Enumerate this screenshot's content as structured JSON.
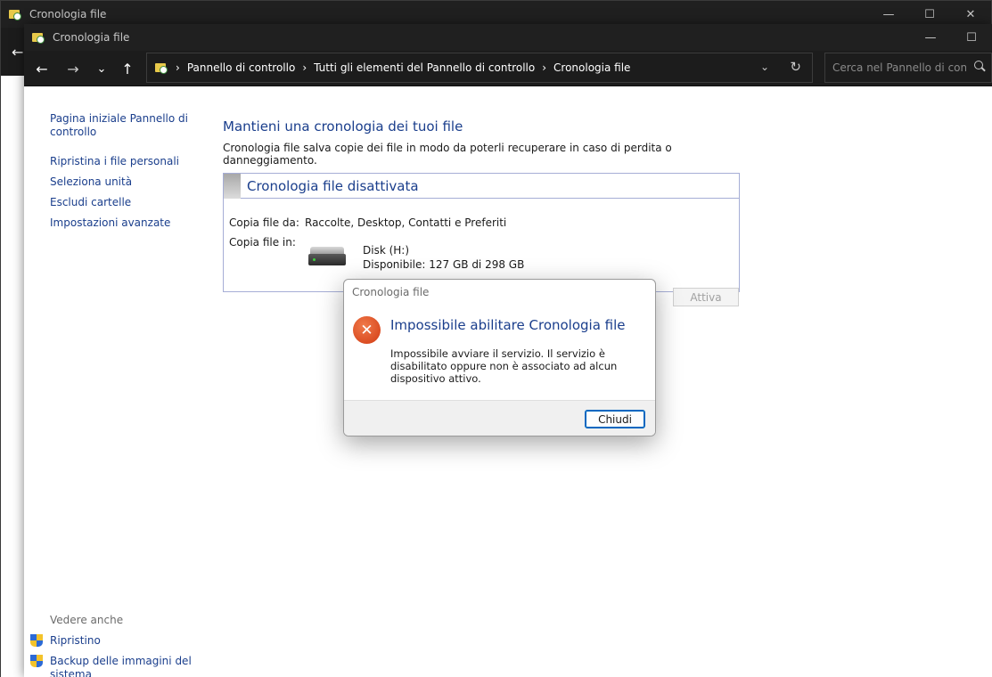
{
  "background_window": {
    "title": "Cronologia file",
    "controls": [
      "—",
      "☐",
      "✕"
    ]
  },
  "main_window": {
    "title": "Cronologia file",
    "controls": [
      "—",
      "☐"
    ]
  },
  "navigation": {
    "back": "←",
    "forward": "→",
    "recent": "⌄",
    "up": "↑",
    "breadcrumb": [
      "Pannello di controllo",
      "Tutti gli elementi del Pannello di controllo",
      "Cronologia file"
    ],
    "separator": "›",
    "dropdown": "⌄",
    "refresh": "↻",
    "search_placeholder": "Cerca nel Pannello di contr..."
  },
  "sidebar": {
    "home_line1": "Pagina iniziale Pannello di",
    "home_line2": "controllo",
    "links": [
      "Ripristina i file personali",
      "Seleziona unità",
      "Escludi cartelle",
      "Impostazioni avanzate"
    ],
    "see_also_label": "Vedere anche",
    "see_also": [
      "Ripristino",
      "Backup delle immagini del sistema"
    ]
  },
  "content": {
    "title": "Mantieni una cronologia dei tuoi file",
    "description": "Cronologia file salva copie dei file in modo da poterli recuperare in caso di perdita o danneggiamento.",
    "status_title": "Cronologia file disattivata",
    "copy_from_label": "Copia file da:",
    "copy_from_value": "Raccolte, Desktop, Contatti e Preferiti",
    "copy_to_label": "Copia file in:",
    "drive_name": "Disk (H:)",
    "drive_available": "Disponibile: 127 GB di 298 GB",
    "activate_button": "Attiva"
  },
  "dialog": {
    "title": "Cronologia file",
    "heading": "Impossibile abilitare Cronologia file",
    "message": "Impossibile avviare il servizio. Il servizio è disabilitato oppure non è associato ad alcun dispositivo attivo.",
    "close_button": "Chiudi",
    "error_glyph": "✕"
  },
  "colors": {
    "link": "#1a3e8c",
    "titlebar": "#202020",
    "error": "#d23a12",
    "accent": "#0067c0"
  }
}
